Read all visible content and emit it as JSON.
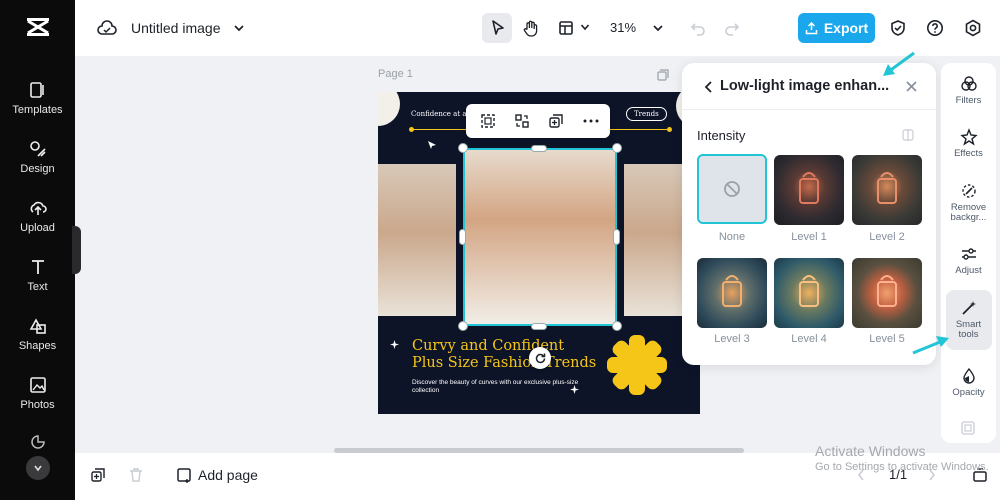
{
  "sidebar": {
    "items": [
      {
        "label": "Templates",
        "icon": "templates-icon"
      },
      {
        "label": "Design",
        "icon": "design-icon"
      },
      {
        "label": "Upload",
        "icon": "upload-icon"
      },
      {
        "label": "Text",
        "icon": "text-icon"
      },
      {
        "label": "Shapes",
        "icon": "shapes-icon"
      },
      {
        "label": "Photos",
        "icon": "photos-icon"
      }
    ]
  },
  "header": {
    "title": "Untitled image",
    "zoom": "31%",
    "export_label": "Export",
    "accent": "#1aa7ec"
  },
  "canvas": {
    "page_label": "Page 1",
    "poster": {
      "tagline": "Confidence at an",
      "badge": "Trends",
      "headline_line1": "Curvy and Confident",
      "headline_line2": "Plus Size Fashion Trends",
      "subtext": "Discover the beauty of curves with our exclusive plus-size collection",
      "accent": "#f5c518"
    }
  },
  "panel": {
    "title": "Low-light image enhan...",
    "section": "Intensity",
    "options": [
      {
        "label": "None"
      },
      {
        "label": "Level 1"
      },
      {
        "label": "Level 2"
      },
      {
        "label": "Level 3"
      },
      {
        "label": "Level 4"
      },
      {
        "label": "Level 5"
      }
    ],
    "selected": "None"
  },
  "right_toolbar": {
    "items": [
      {
        "label": "Filters"
      },
      {
        "label": "Effects"
      },
      {
        "label": "Remove backgr..."
      },
      {
        "label": "Adjust"
      },
      {
        "label": "Smart tools"
      },
      {
        "label": "Opacity"
      }
    ],
    "active": "Smart tools"
  },
  "footer": {
    "add_page": "Add page",
    "pager": "1/1"
  },
  "watermark": {
    "line1": "Activate Windows",
    "line2": "Go to Settings to activate Windows."
  }
}
